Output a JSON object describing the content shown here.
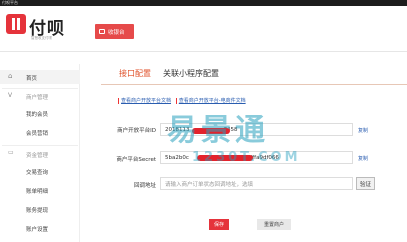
{
  "window": {
    "title": "付呗平台"
  },
  "header": {
    "brand": "付呗",
    "brand_sub": "智慧收支付呗",
    "cashier_label": "收银台"
  },
  "sidebar": {
    "home": "首页",
    "merchant_group": "商户管理",
    "my_merchants": "我的会员",
    "member_query": "会员营销",
    "funds_group": "资金管理",
    "trade_query": "交易查询",
    "settle_detail": "账单明细",
    "withdraw": "账务提现",
    "account_settings": "账户设置"
  },
  "tabs": [
    {
      "label": "接口配置"
    },
    {
      "label": "关联小程序配置"
    }
  ],
  "links": {
    "link1": "查看商户开放平台文档",
    "link2": "查看商户开放平台-电商件文档"
  },
  "form": {
    "app_id_label": "商户开放平台ID",
    "app_id_value_start": "2018113",
    "app_id_value_end": "7458",
    "secret_label": "商户平台Secret",
    "secret_value_start": "5ba2b0c",
    "secret_value_end": "3d1fffa9df066",
    "callback_label": "回调地址",
    "callback_placeholder": "请输入商户订单状态回调地址，选填",
    "copy1": "复制",
    "copy2": "复制",
    "verify": "验证"
  },
  "buttons": {
    "save": "保存",
    "reset": "重置商户"
  },
  "watermark": {
    "main": "易景通",
    "sub": "1230T.COM"
  },
  "colors": {
    "brand_red": "#e5333b",
    "accent_orange": "#e0522b",
    "link_blue": "#2a5db0"
  }
}
